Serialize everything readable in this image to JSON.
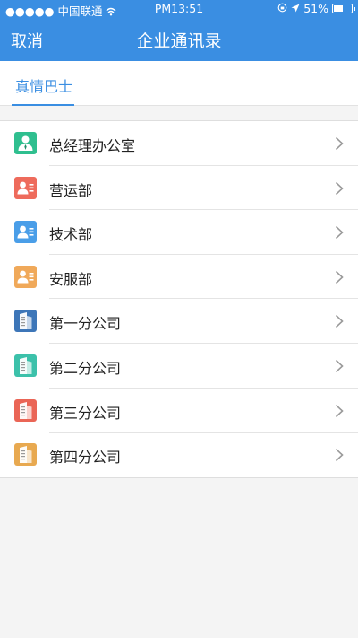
{
  "status_bar": {
    "signal": "●●●●● 中国联通 ",
    "time": "PM13:51",
    "battery": "51%",
    "battery_level": 0.51
  },
  "navbar": {
    "cancel_label": "取消",
    "title": "企业通讯录"
  },
  "tabs": [
    {
      "label": "真情巴士",
      "active": true
    }
  ],
  "departments": [
    {
      "label": "总经理办公室",
      "icon": "person-icon",
      "color": "#2fbf8f"
    },
    {
      "label": "营运部",
      "icon": "contact-card-icon",
      "color": "#ee6b5c"
    },
    {
      "label": "技术部",
      "icon": "contact-card-icon",
      "color": "#4a9ee8"
    },
    {
      "label": "安服部",
      "icon": "contact-card-icon",
      "color": "#f0a95a"
    },
    {
      "label": "第一分公司",
      "icon": "building-icon",
      "color": "#3d76b8"
    },
    {
      "label": "第二分公司",
      "icon": "building-icon",
      "color": "#3cc1aa"
    },
    {
      "label": "第三分公司",
      "icon": "building-icon",
      "color": "#ea6556"
    },
    {
      "label": "第四分公司",
      "icon": "building-icon",
      "color": "#e8a950"
    }
  ]
}
